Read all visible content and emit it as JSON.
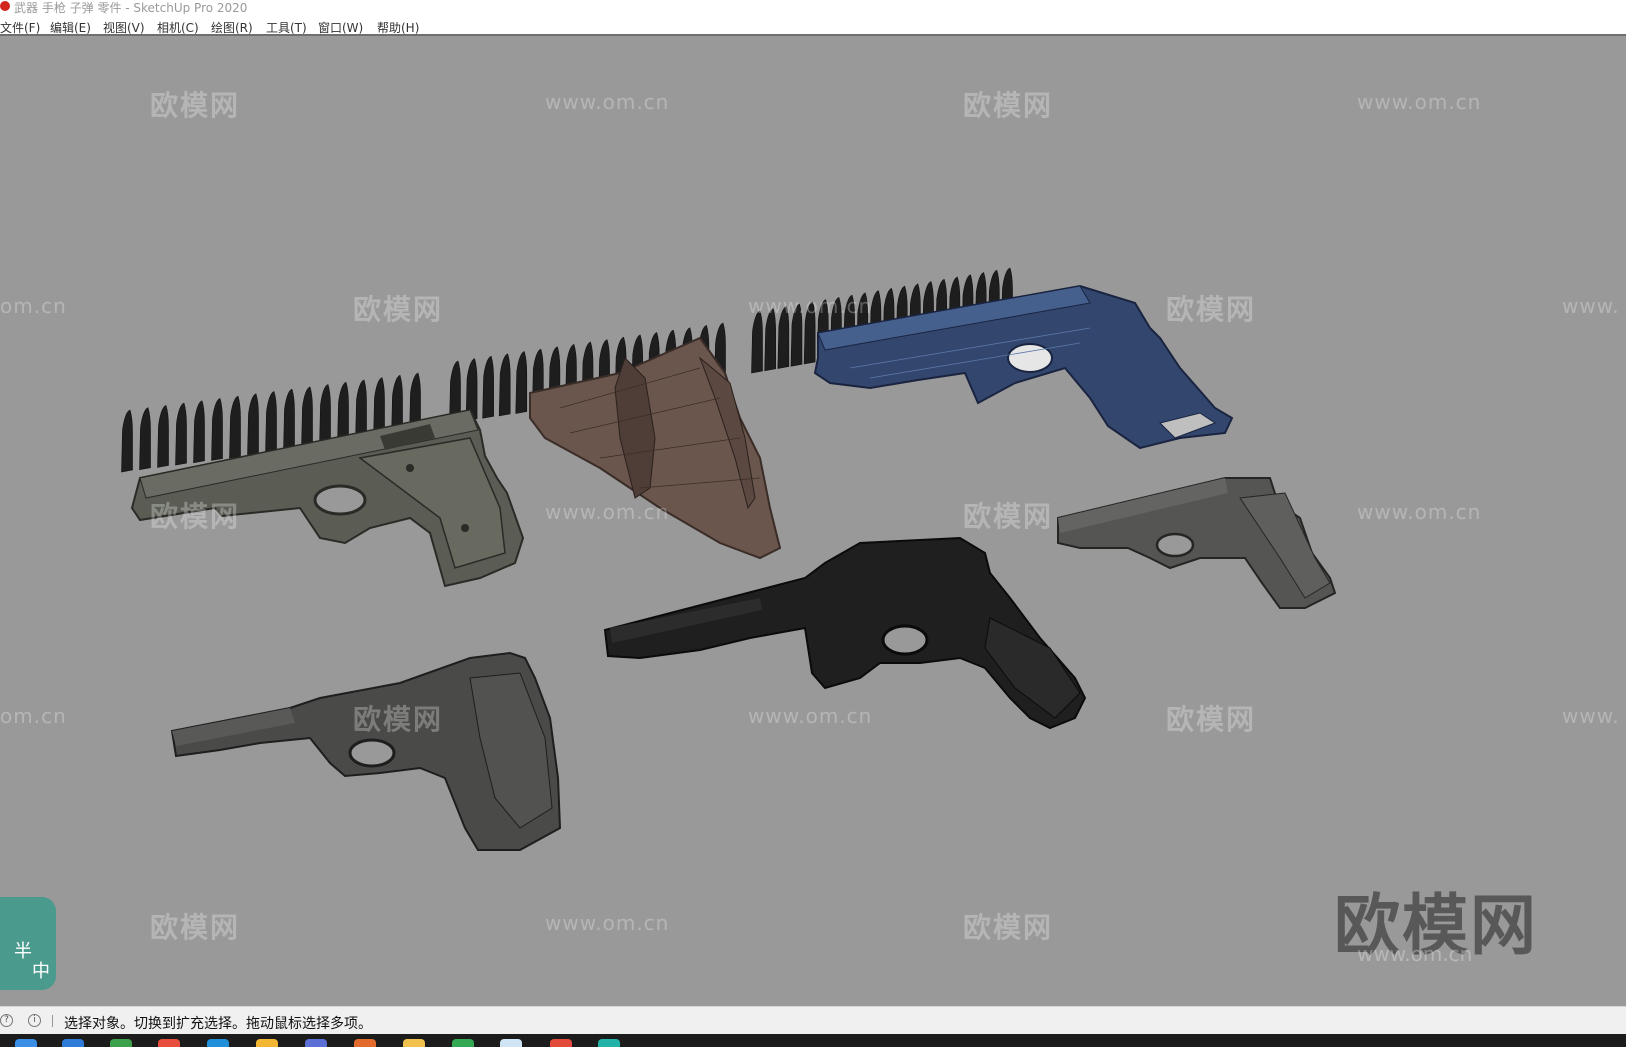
{
  "window": {
    "title": "武器 手枪 子弹 零件 - SketchUp Pro 2020",
    "app_icon": "sketchup-icon"
  },
  "menu": [
    {
      "label": "文件(F)"
    },
    {
      "label": "编辑(E)"
    },
    {
      "label": "视图(V)"
    },
    {
      "label": "相机(C)"
    },
    {
      "label": "绘图(R)"
    },
    {
      "label": "工具(T)"
    },
    {
      "label": "窗口(W)"
    },
    {
      "label": "帮助(H)"
    }
  ],
  "watermark": {
    "brand": "欧模网",
    "url": "www.om.cn",
    "url_short": "om.cn",
    "url_prefix": "www."
  },
  "widget": {
    "chars": [
      "半",
      "中"
    ]
  },
  "status": {
    "text": "选择对象。切换到扩充选择。拖动鼠标选择多项。",
    "icons": [
      "geolocation-icon",
      "info-icon"
    ]
  },
  "colors": {
    "viewport_bg": "#999999",
    "bullet": "#1e1e1e",
    "colt_body": "#5b5d55",
    "holster": "#6b564e",
    "toy_pistol": "#33476e",
    "mauser": "#1f1f1f",
    "walther": "#4a4a48",
    "beretta": "#555553",
    "widget_bg": "#4a9a8e"
  },
  "taskbar": {
    "icons": [
      "explorer-icon",
      "store-icon",
      "browser-icon",
      "edge-icon",
      "folder-icon",
      "chrome-icon",
      "office-icon",
      "files-icon",
      "app-icon",
      "image-icon",
      "mail-icon",
      "media-icon"
    ]
  }
}
